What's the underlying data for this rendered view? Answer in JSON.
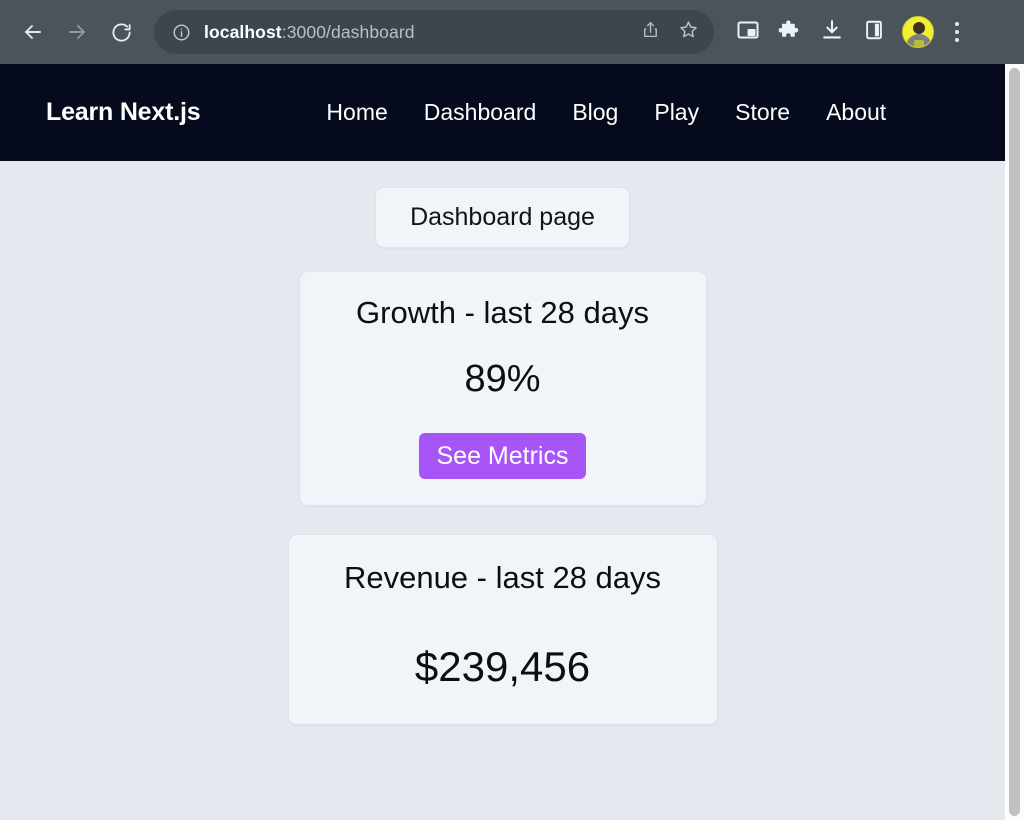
{
  "browser": {
    "back_icon": "back-arrow-icon",
    "forward_icon": "forward-arrow-icon",
    "reload_icon": "reload-icon",
    "site_info_icon": "info-circle-icon",
    "url_host": "localhost",
    "url_path": ":3000/dashboard",
    "share_icon": "share-icon",
    "bookmark_icon": "star-icon",
    "picture_in_picture_icon": "picture-in-picture-icon",
    "extensions_icon": "puzzle-piece-icon",
    "downloads_icon": "download-icon",
    "side_panel_icon": "side-panel-icon",
    "avatar_icon": "user-avatar",
    "menu_icon": "three-dot-menu-icon",
    "toolbar_bg": "#4b545a",
    "omnibox_bg": "#3c464c"
  },
  "site": {
    "brand": "Learn Next.js",
    "nav_bg": "#050a1c",
    "nav_links": [
      {
        "label": "Home"
      },
      {
        "label": "Dashboard"
      },
      {
        "label": "Blog"
      },
      {
        "label": "Play"
      },
      {
        "label": "Store"
      },
      {
        "label": "About"
      }
    ]
  },
  "page": {
    "background": "#e4e9f0",
    "page_label": "Dashboard page",
    "cards": [
      {
        "title": "Growth - last 28 days",
        "value": "89%",
        "button_label": "See Metrics",
        "button_color": "#a855f7"
      },
      {
        "title": "Revenue - last 28 days",
        "value": "$239,456"
      }
    ]
  }
}
